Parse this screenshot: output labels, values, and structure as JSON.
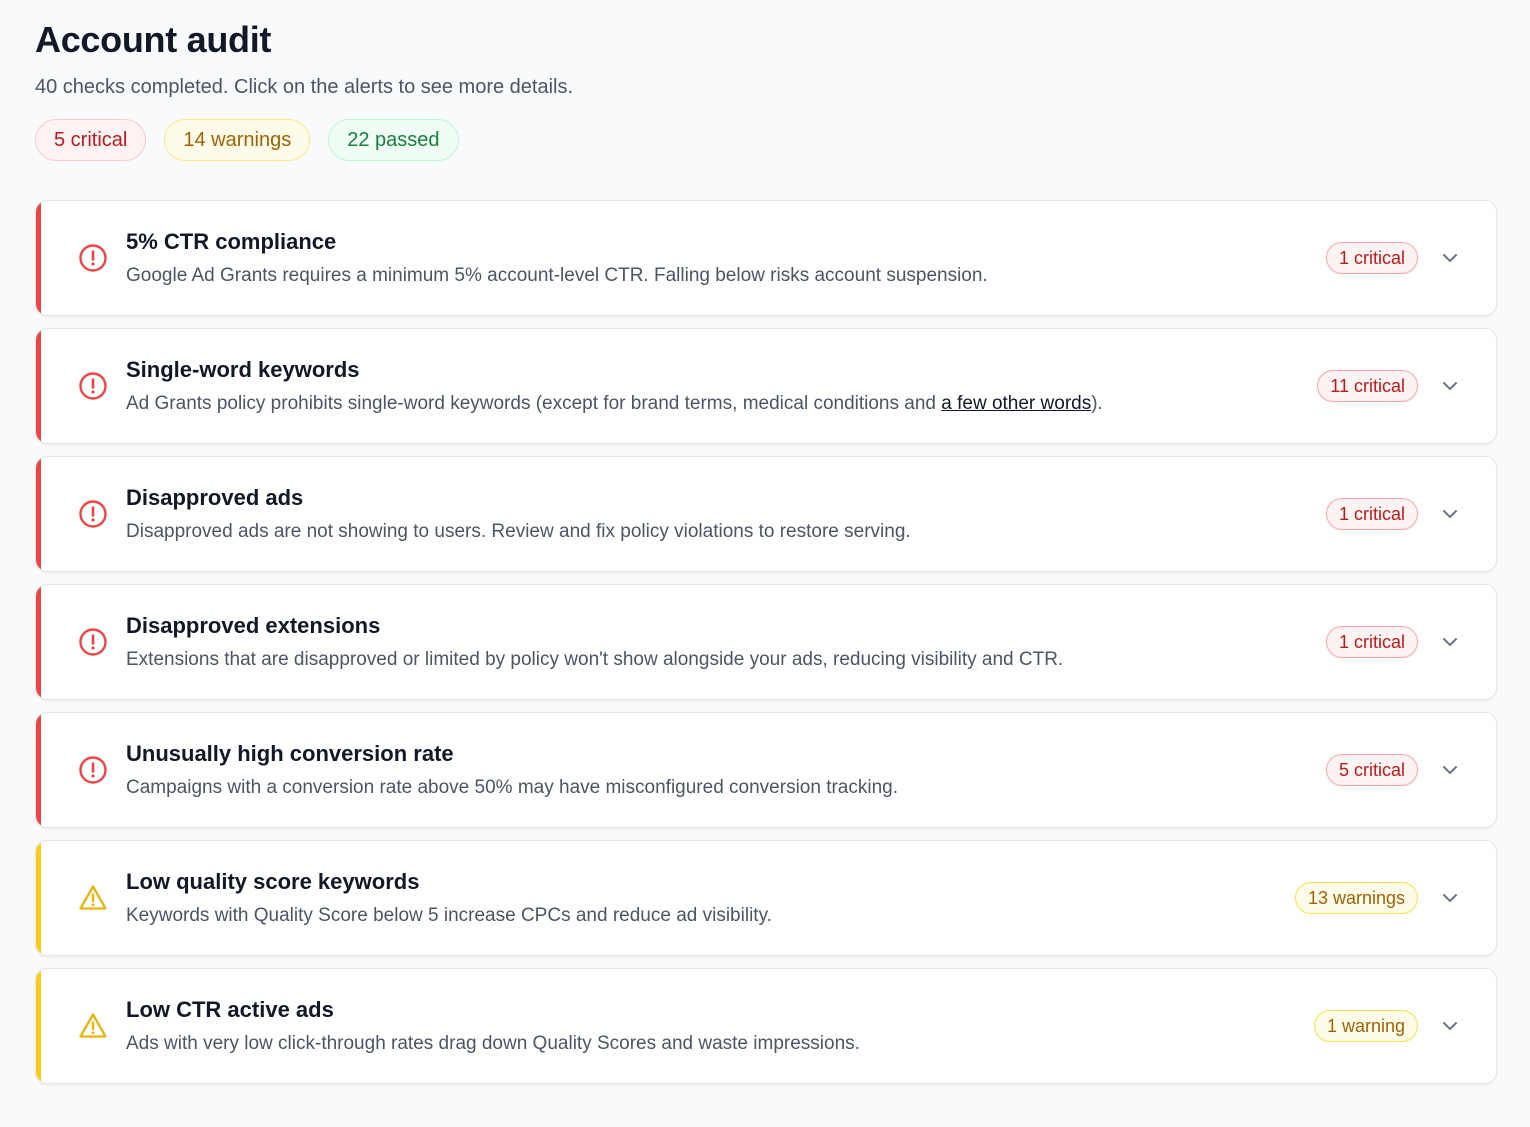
{
  "header": {
    "title": "Account audit",
    "subtitle": "40 checks completed. Click on the alerts to see more details."
  },
  "summary": {
    "critical": "5 critical",
    "warnings": "14 warnings",
    "passed": "22 passed"
  },
  "colors": {
    "critical": "#ef4444",
    "warning": "#facc15",
    "passed": "#15803d"
  },
  "checks": [
    {
      "severity": "critical",
      "icon": "alert-circle-icon",
      "title": "5% CTR compliance",
      "description": "Google Ad Grants requires a minimum 5% account-level CTR. Falling below risks account suspension.",
      "badge": "1 critical"
    },
    {
      "severity": "critical",
      "icon": "alert-circle-icon",
      "title": "Single-word keywords",
      "description_before": "Ad Grants policy prohibits single-word keywords (except for brand terms, medical conditions and ",
      "description_link": "a few other words",
      "description_after": ").",
      "badge": "11 critical"
    },
    {
      "severity": "critical",
      "icon": "alert-circle-icon",
      "title": "Disapproved ads",
      "description": "Disapproved ads are not showing to users. Review and fix policy violations to restore serving.",
      "badge": "1 critical"
    },
    {
      "severity": "critical",
      "icon": "alert-circle-icon",
      "title": "Disapproved extensions",
      "description": "Extensions that are disapproved or limited by policy won't show alongside your ads, reducing visibility and CTR.",
      "badge": "1 critical"
    },
    {
      "severity": "critical",
      "icon": "alert-circle-icon",
      "title": "Unusually high conversion rate",
      "description": "Campaigns with a conversion rate above 50% may have misconfigured conversion tracking.",
      "badge": "5 critical"
    },
    {
      "severity": "warning",
      "icon": "alert-triangle-icon",
      "title": "Low quality score keywords",
      "description": "Keywords with Quality Score below 5 increase CPCs and reduce ad visibility.",
      "badge": "13 warnings"
    },
    {
      "severity": "warning",
      "icon": "alert-triangle-icon",
      "title": "Low CTR active ads",
      "description": "Ads with very low click-through rates drag down Quality Scores and waste impressions.",
      "badge": "1 warning"
    }
  ]
}
